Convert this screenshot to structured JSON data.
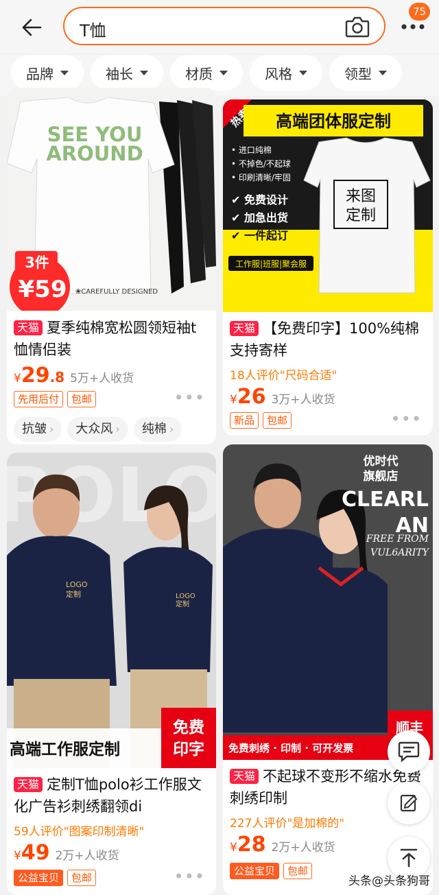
{
  "search": {
    "query": "T恤"
  },
  "cart_badge": "75",
  "filters": [
    {
      "label": "品牌"
    },
    {
      "label": "袖长"
    },
    {
      "label": "材质"
    },
    {
      "label": "风格"
    },
    {
      "label": "领型"
    }
  ],
  "products": [
    {
      "image_text": {
        "l1": "SEE YOU",
        "l2": "AROUND",
        "foot": "❀CAREFULLY DESIGNED",
        "promo_top": "3件",
        "promo_price": "¥59"
      },
      "platform_badge": "天猫",
      "title": "夏季纯棉宽松圆领短袖t恤情侣装",
      "review": "",
      "currency": "¥",
      "price_int": "29",
      "price_dec": ".8",
      "sold": "5万+人收货",
      "tags": [
        "先用后付",
        "包邮"
      ],
      "keywords": [
        "抗皱",
        "大众风",
        "纯棉"
      ]
    },
    {
      "image_text": {
        "hot": "热卖",
        "headline": "高端团体服定制",
        "b1": "• 进口纯棉",
        "b2": "• 不掉色/不起球",
        "b3": "• 印刷清晰/牢固",
        "c1": "✔ 免费设计",
        "c2": "✔ 加急出货",
        "c3": "✔ 一件起订",
        "bottom": "工作服|班服|聚会服",
        "stamp1": "来图",
        "stamp2": "定制"
      },
      "platform_badge": "天猫",
      "title": "【免费印字】100%纯棉支持寄样",
      "review": "18人评价\"尺码合适\"",
      "currency": "¥",
      "price_int": "26",
      "price_dec": "",
      "sold": "3万+人收货",
      "tags": [
        "新品",
        "包邮"
      ],
      "keywords": []
    },
    {
      "image_text": {
        "bg": "POLO",
        "logo1": "LOGO\n定制",
        "banner": "高端工作服定制",
        "free": "免费\n印字"
      },
      "platform_badge": "天猫",
      "title": "定制T恤polo衫工作服文化广告衫刺绣翻领di",
      "review": "59人评价\"图案印制清晰\"",
      "currency": "¥",
      "price_int": "49",
      "price_dec": "",
      "sold": "2万+人收货",
      "tags": [
        "公益宝贝",
        "包邮"
      ],
      "keywords": []
    },
    {
      "image_text": {
        "shop1": "优时代",
        "shop2": "旗舰店",
        "brand1": "CLEARL",
        "brand2": "AN",
        "slogan1": "FREE FROM",
        "slogan2": "VUL6ARITY",
        "bottom": "免费刺绣 · 印制 · 可开发票",
        "corner": "顺丰"
      },
      "platform_badge": "天猫",
      "title": "不起球不变形不缩水免费刺绣印制",
      "review": "227人评价\"是加棉的\"",
      "currency": "¥",
      "price_int": "28",
      "price_dec": "",
      "sold": "2万+人收货",
      "tags": [
        "公益宝贝",
        "包邮"
      ],
      "keywords": []
    }
  ],
  "watermark": "头条@头条狗哥"
}
